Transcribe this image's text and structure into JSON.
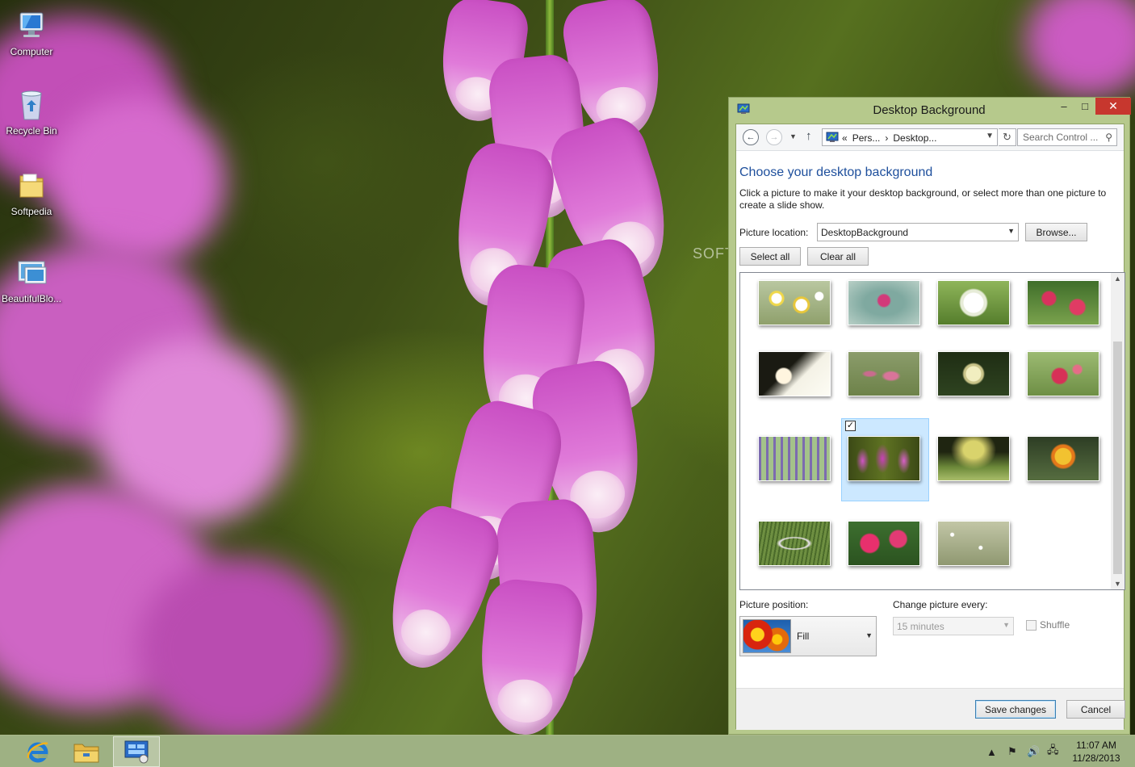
{
  "desktop": {
    "icons": [
      {
        "label": "Computer",
        "icon": "computer-icon"
      },
      {
        "label": "Recycle Bin",
        "icon": "recycle-bin-icon"
      },
      {
        "label": "Softpedia",
        "icon": "folder-icon"
      },
      {
        "label": "BeautifulBlo...",
        "icon": "theme-pack-icon"
      }
    ],
    "watermark": "SOFTP"
  },
  "window": {
    "title": "Desktop Background",
    "controls": {
      "minimize": "–",
      "maximize": "□",
      "close": "✕"
    },
    "nav": {
      "crumb_prefix": "«",
      "crumbs": [
        "Pers...",
        "Desktop..."
      ],
      "search_placeholder": "Search Control ..."
    },
    "heading": "Choose your desktop background",
    "description": "Click a picture to make it your desktop background, or select more than one picture to create a slide show.",
    "location": {
      "label": "Picture location:",
      "value": "DesktopBackground",
      "browse": "Browse..."
    },
    "select_all": "Select all",
    "clear_all": "Clear all",
    "pictures": [
      {
        "name": "daisies",
        "selected": false
      },
      {
        "name": "pink-blossom",
        "selected": false
      },
      {
        "name": "white-lace-flower",
        "selected": false
      },
      {
        "name": "red-flowers-bush",
        "selected": false
      },
      {
        "name": "white-magnolia-branch",
        "selected": false
      },
      {
        "name": "pink-spikes",
        "selected": false
      },
      {
        "name": "white-rose-dark",
        "selected": false
      },
      {
        "name": "red-flower-green",
        "selected": false
      },
      {
        "name": "lavender-field",
        "selected": false
      },
      {
        "name": "foxglove",
        "selected": true
      },
      {
        "name": "meadow-sunset",
        "selected": false
      },
      {
        "name": "yellow-lily",
        "selected": false
      },
      {
        "name": "flower-wreath-grass",
        "selected": false
      },
      {
        "name": "pink-petunias",
        "selected": false
      },
      {
        "name": "baby-breath-field",
        "selected": false
      }
    ],
    "position": {
      "label": "Picture position:",
      "value": "Fill"
    },
    "interval": {
      "label": "Change picture every:",
      "value": "15 minutes"
    },
    "shuffle": {
      "label": "Shuffle",
      "checked": false
    },
    "save": "Save changes",
    "cancel": "Cancel"
  },
  "taskbar": {
    "pinned": [
      "internet-explorer-icon",
      "file-explorer-icon",
      "control-panel-icon"
    ],
    "active": "control-panel-icon",
    "time": "11:07 AM",
    "date": "11/28/2013"
  },
  "colors": {
    "accent_heading": "#1e4f9c",
    "window_frame": "#b6c98c",
    "close_button": "#c7372e",
    "selection": "#cce8ff"
  }
}
